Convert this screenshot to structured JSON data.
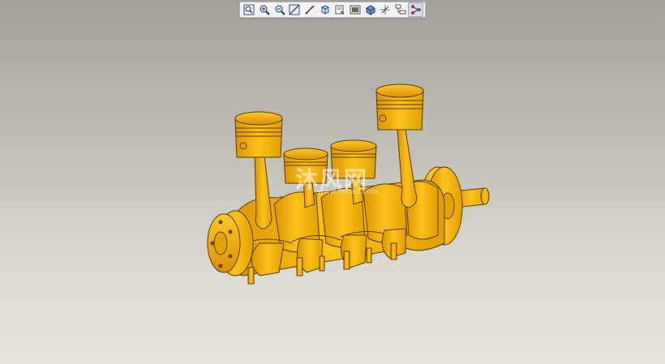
{
  "toolbar": {
    "buttons": [
      {
        "icon": "zoom-fit-icon"
      },
      {
        "icon": "zoom-in-icon"
      },
      {
        "icon": "zoom-out-icon"
      },
      {
        "icon": "repaint-icon"
      },
      {
        "icon": "orient-icon"
      },
      {
        "icon": "view-cube-icon"
      },
      {
        "icon": "saved-views-icon"
      },
      {
        "icon": "display-style-icon"
      },
      {
        "icon": "shaded-icon"
      },
      {
        "icon": "spin-center-icon"
      },
      {
        "icon": "model-tree-icon"
      },
      {
        "icon": "explode-icon"
      }
    ],
    "active_button": "explode-icon"
  },
  "model": {
    "name": "crankshaft-piston-assembly",
    "color": "#f4b400",
    "edge_color": "#5a3a00"
  },
  "watermark": {
    "text": "沐风网",
    "url": "www.mfcad.com"
  },
  "background": {
    "top": "#a3a29a",
    "bottom": "#e6e5dd"
  }
}
